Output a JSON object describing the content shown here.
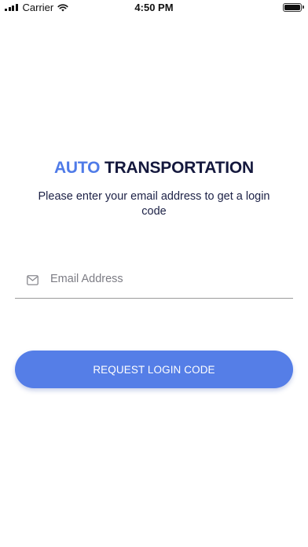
{
  "status_bar": {
    "carrier": "Carrier",
    "time": "4:50 PM",
    "icons": [
      "signal-icon",
      "wifi-icon",
      "battery-icon"
    ]
  },
  "title": {
    "accent_word": "AUTO",
    "main_word": "TRANSPORTATION",
    "accent_color": "#4f7be8",
    "main_color": "#14183d"
  },
  "subtitle": "Please enter your email address to get a login code",
  "email_field": {
    "icon": "mail-icon",
    "value": "",
    "placeholder": "Email Address"
  },
  "request_button": {
    "label": "REQUEST LOGIN CODE",
    "color": "#557ee7"
  }
}
